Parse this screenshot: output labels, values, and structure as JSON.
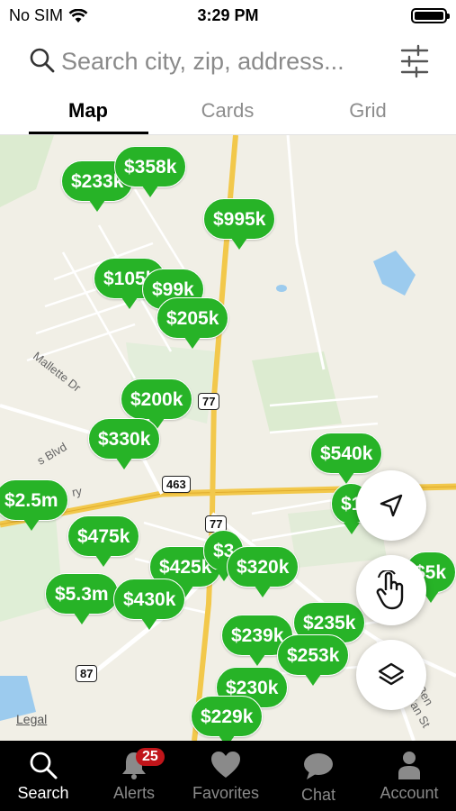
{
  "status_bar": {
    "carrier": "No SIM",
    "time": "3:29 PM"
  },
  "search": {
    "placeholder": "Search city, zip, address..."
  },
  "tabs": [
    {
      "label": "Map",
      "active": true
    },
    {
      "label": "Cards",
      "active": false
    },
    {
      "label": "Grid",
      "active": false
    }
  ],
  "map": {
    "street_labels": [
      "Mallette Dr",
      "s Blvd",
      "ry",
      "N Ben Jordan St"
    ],
    "route_shields": [
      "77",
      "463",
      "77",
      "87"
    ],
    "legal": "Legal",
    "price_pins": [
      "$233k",
      "$358k",
      "$995k",
      "$105k",
      "$99k",
      "$205k",
      "$200k",
      "$330k",
      "$540k",
      "$2.5m",
      "$1",
      "$475k",
      "$425k",
      "$3",
      "$320k",
      "$5k",
      "$5.3m",
      "$430k",
      "$235k",
      "$239k",
      "$253k",
      "$230k",
      "$229k"
    ],
    "pin_color": "#27b327"
  },
  "nav": {
    "items": [
      {
        "label": "Search",
        "icon": "search-icon",
        "active": true
      },
      {
        "label": "Alerts",
        "icon": "bell-icon",
        "badge": "25"
      },
      {
        "label": "Favorites",
        "icon": "heart-icon"
      },
      {
        "label": "Chat",
        "icon": "chat-icon"
      },
      {
        "label": "Account",
        "icon": "person-icon"
      }
    ]
  }
}
